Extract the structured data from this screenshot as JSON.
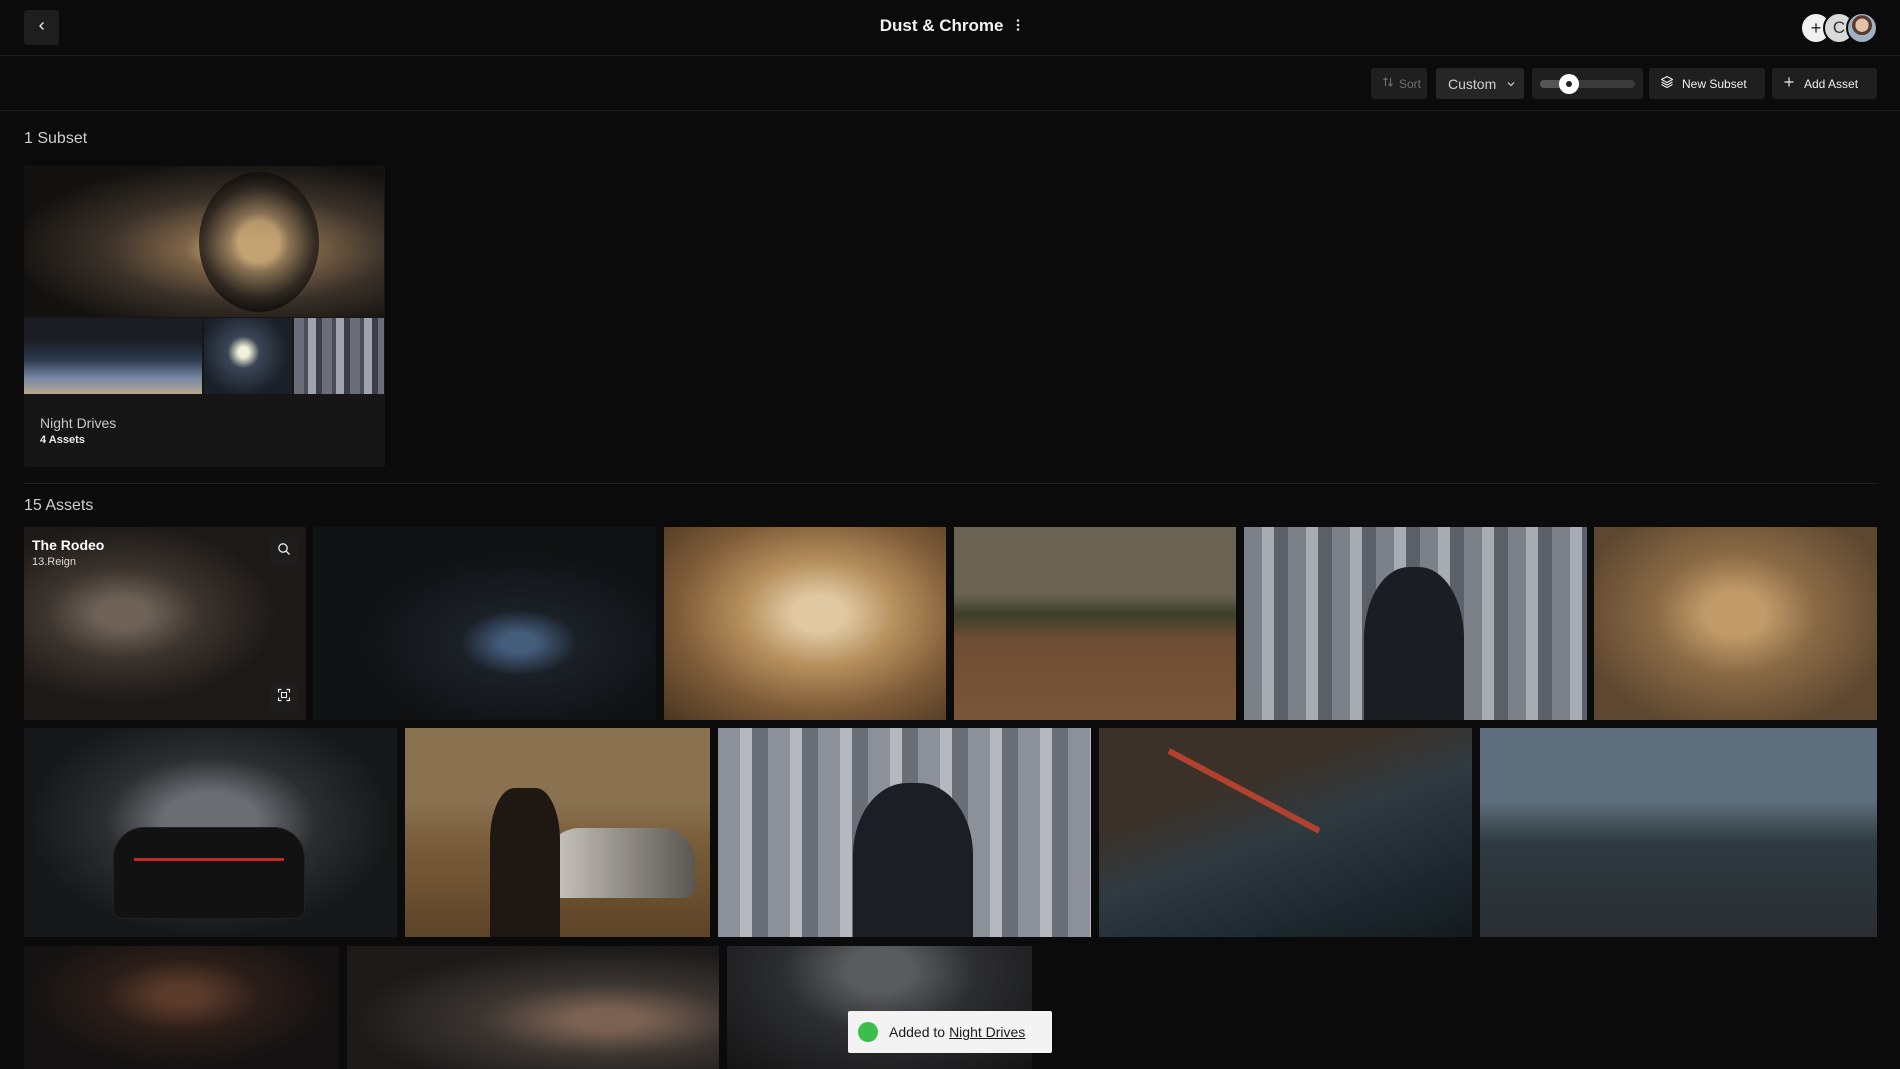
{
  "header": {
    "title": "Dust & Chrome",
    "avatar_letter": "C"
  },
  "toolbar": {
    "sort_label": "Sort",
    "order_value": "Custom",
    "zoom_level": 0.3,
    "new_subset_label": "New Subset",
    "add_asset_label": "Add Asset"
  },
  "subsets": {
    "section_label": "1 Subset",
    "items": [
      {
        "name": "Night Drives",
        "count": "4 Assets"
      }
    ]
  },
  "assets": {
    "section_label": "15 Assets",
    "items": [
      {
        "title": "The Rodeo",
        "subtitle": "13.Reign"
      }
    ]
  },
  "toast": {
    "prefix": "Added to",
    "link": "Night Drives"
  },
  "colors": {
    "background": "#0b0b0b",
    "toolbar_button": "#1f1f1f",
    "toast_success": "#3dbd4a"
  }
}
